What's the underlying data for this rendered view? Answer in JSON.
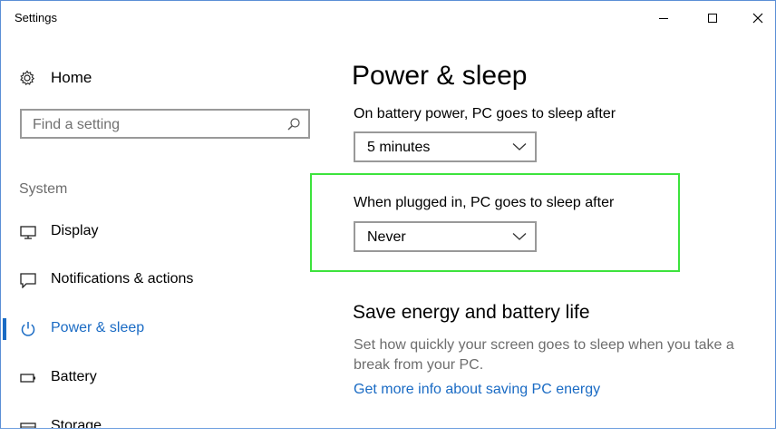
{
  "window": {
    "title": "Settings"
  },
  "sidebar": {
    "home_label": "Home",
    "search_placeholder": "Find a setting",
    "section_label": "System",
    "items": [
      {
        "label": "Display",
        "icon": "monitor-icon",
        "active": false
      },
      {
        "label": "Notifications & actions",
        "icon": "message-icon",
        "active": false
      },
      {
        "label": "Power & sleep",
        "icon": "power-icon",
        "active": true
      },
      {
        "label": "Battery",
        "icon": "battery-icon",
        "active": false
      },
      {
        "label": "Storage",
        "icon": "storage-icon",
        "active": false
      }
    ]
  },
  "main": {
    "title": "Power & sleep",
    "battery_label": "On battery power, PC goes to sleep after",
    "battery_value": "5 minutes",
    "plugged_label": "When plugged in, PC goes to sleep after",
    "plugged_value": "Never",
    "save_heading": "Save energy and battery life",
    "save_description": "Set how quickly your screen goes to sleep when you take a break from your PC.",
    "more_info_link": "Get more info about saving PC energy"
  },
  "colors": {
    "accent": "#1a6bc4",
    "highlight": "#3de33d"
  }
}
